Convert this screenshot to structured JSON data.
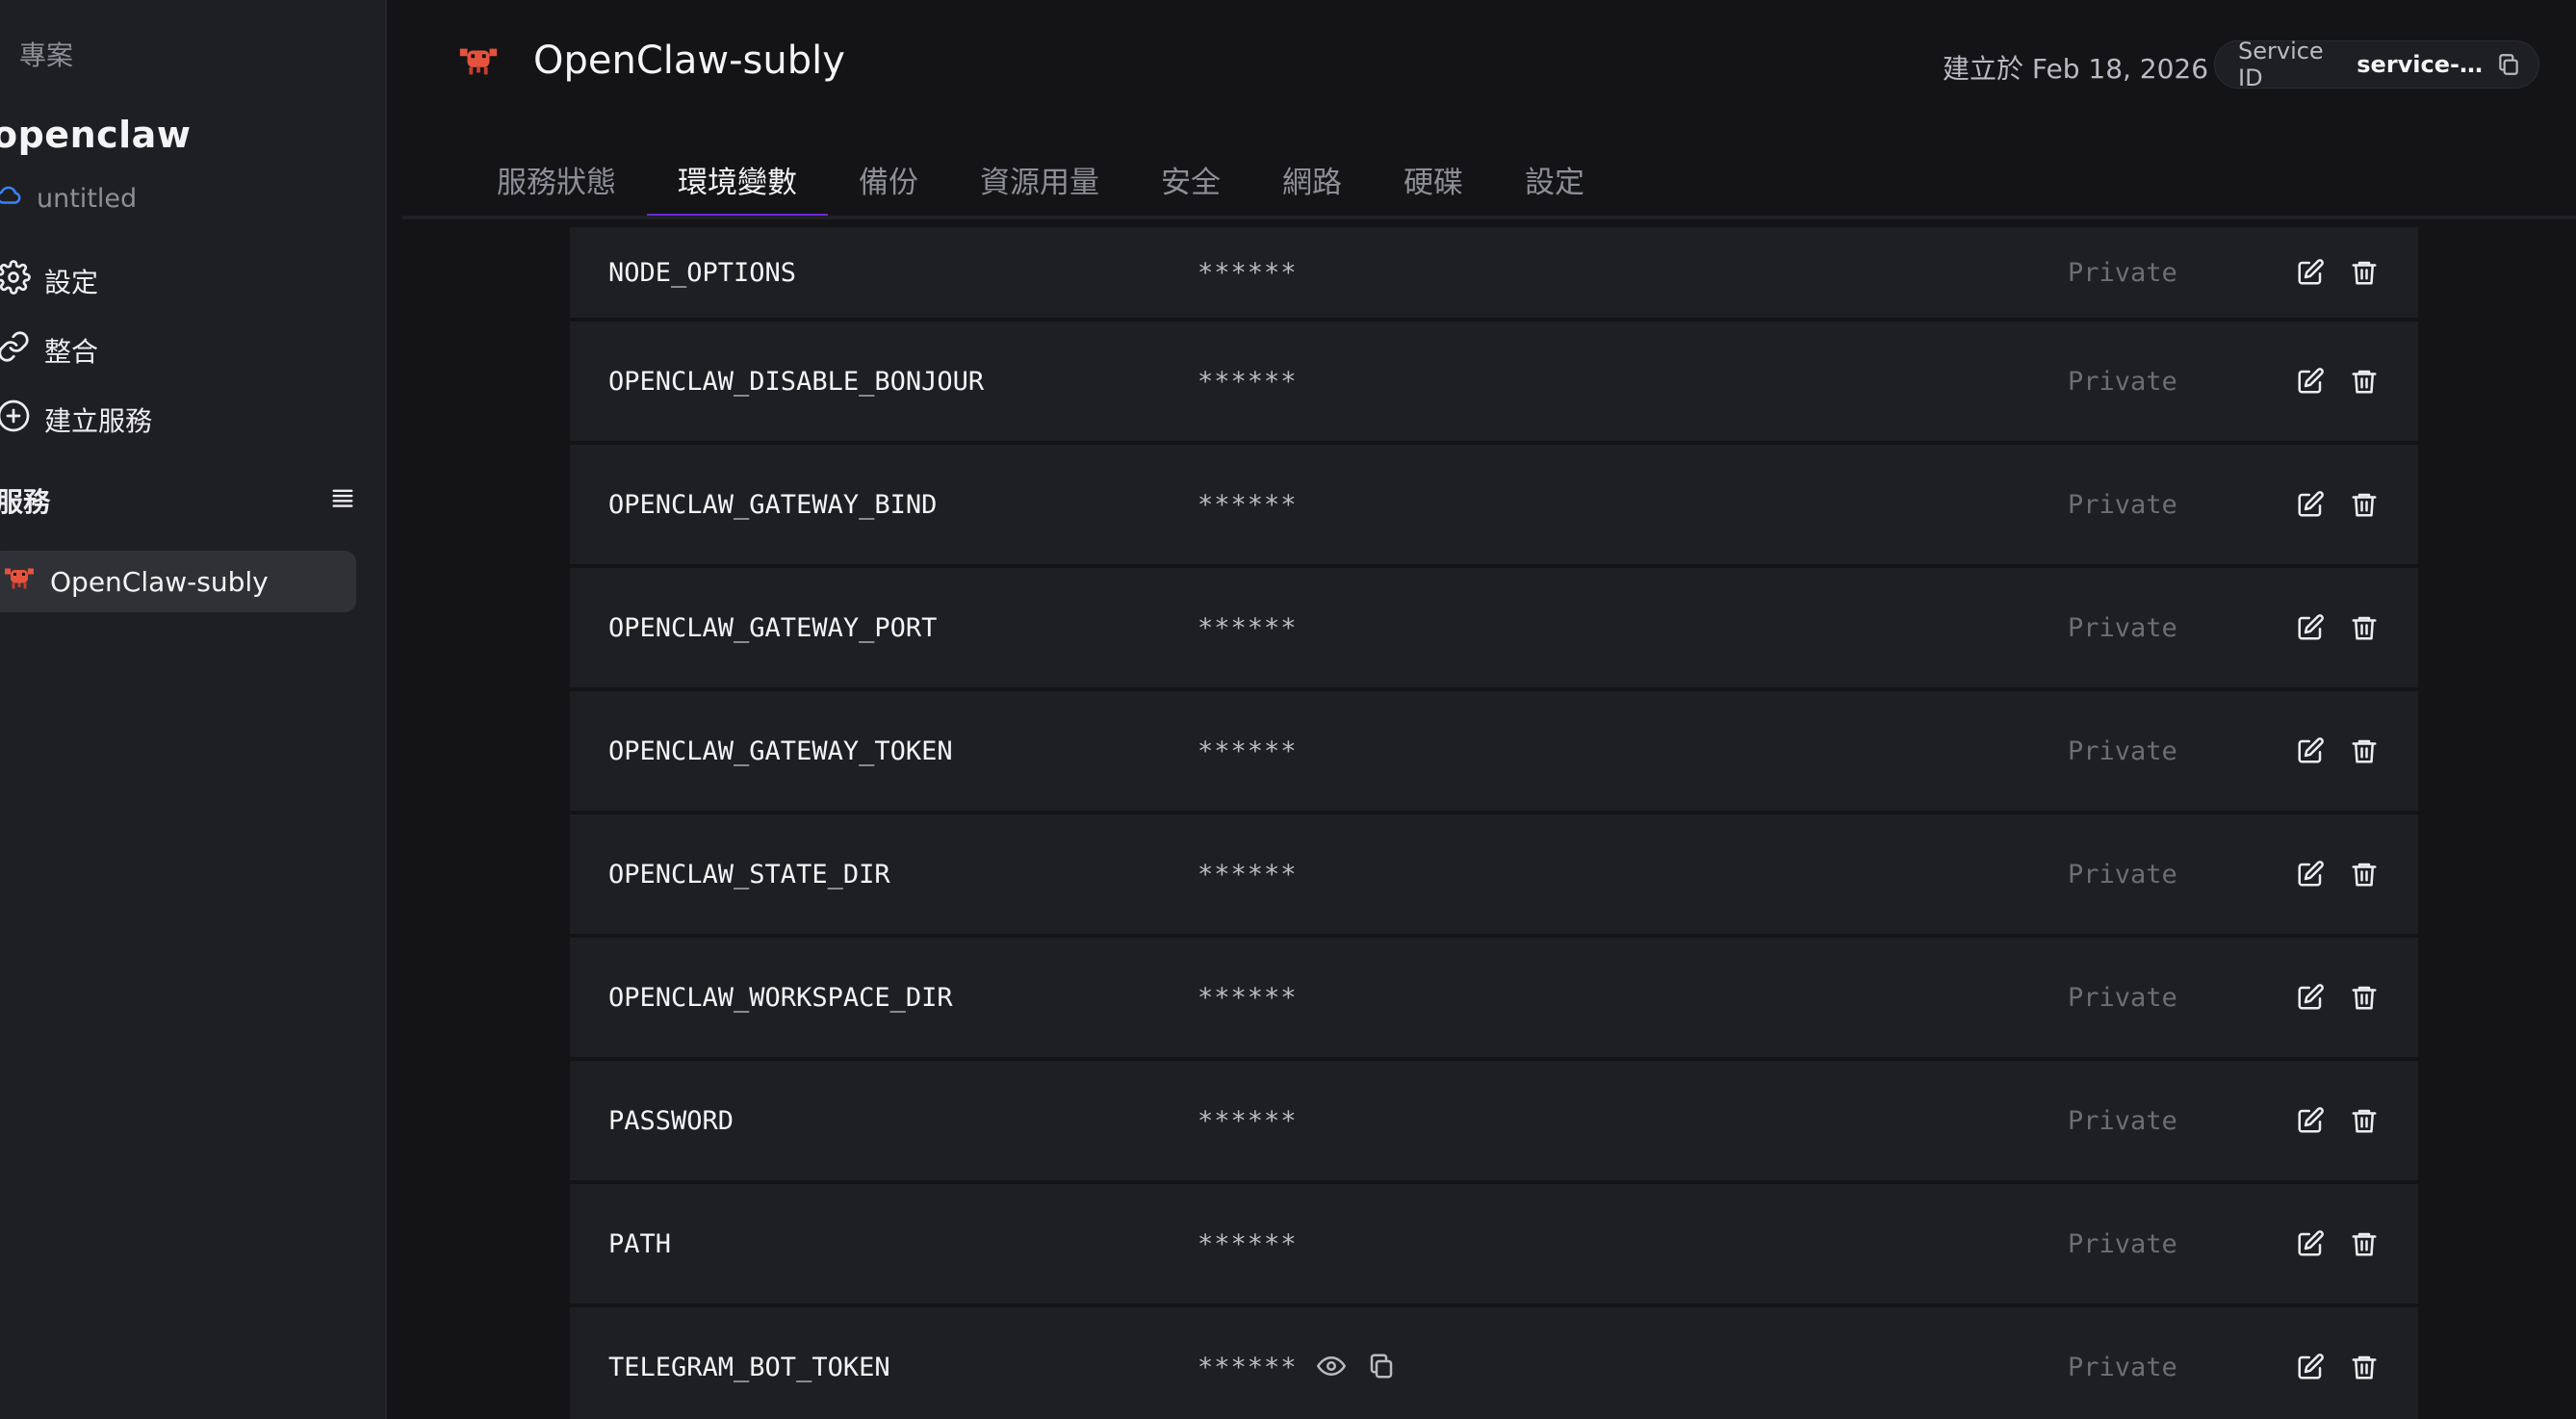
{
  "sidebar": {
    "section_label": "專案",
    "project_name": "openclaw",
    "workspace_name": "untitled",
    "nav": [
      {
        "label": "設定",
        "icon": "gear-icon"
      },
      {
        "label": "整合",
        "icon": "link-icon"
      },
      {
        "label": "建立服務",
        "icon": "plus-circle-icon"
      }
    ],
    "services_label": "服務",
    "services": [
      {
        "label": "OpenClaw-subly",
        "icon": "crab-icon"
      }
    ]
  },
  "header": {
    "title": "OpenClaw-subly",
    "created": "建立於 Feb 18, 2026",
    "service_id_label": "Service ID",
    "service_id_value": "service-…"
  },
  "tabs": [
    {
      "label": "服務狀態",
      "active": false
    },
    {
      "label": "環境變數",
      "active": true
    },
    {
      "label": "備份",
      "active": false
    },
    {
      "label": "資源用量",
      "active": false
    },
    {
      "label": "安全",
      "active": false
    },
    {
      "label": "網路",
      "active": false
    },
    {
      "label": "硬碟",
      "active": false
    },
    {
      "label": "設定",
      "active": false
    }
  ],
  "env_vars": [
    {
      "key": "NODE_OPTIONS",
      "value": "******",
      "visibility": "Private"
    },
    {
      "key": "OPENCLAW_DISABLE_BONJOUR",
      "value": "******",
      "visibility": "Private"
    },
    {
      "key": "OPENCLAW_GATEWAY_BIND",
      "value": "******",
      "visibility": "Private"
    },
    {
      "key": "OPENCLAW_GATEWAY_PORT",
      "value": "******",
      "visibility": "Private"
    },
    {
      "key": "OPENCLAW_GATEWAY_TOKEN",
      "value": "******",
      "visibility": "Private"
    },
    {
      "key": "OPENCLAW_STATE_DIR",
      "value": "******",
      "visibility": "Private"
    },
    {
      "key": "OPENCLAW_WORKSPACE_DIR",
      "value": "******",
      "visibility": "Private"
    },
    {
      "key": "PASSWORD",
      "value": "******",
      "visibility": "Private"
    },
    {
      "key": "PATH",
      "value": "******",
      "visibility": "Private"
    },
    {
      "key": "TELEGRAM_BOT_TOKEN",
      "value": "******",
      "visibility": "Private",
      "hover": true
    }
  ],
  "colors": {
    "accent": "#6d28d9",
    "sidebar_bg": "#1e1f23",
    "page_bg": "#141417",
    "row_bg": "#1e1f23",
    "muted": "#6c6d75"
  }
}
